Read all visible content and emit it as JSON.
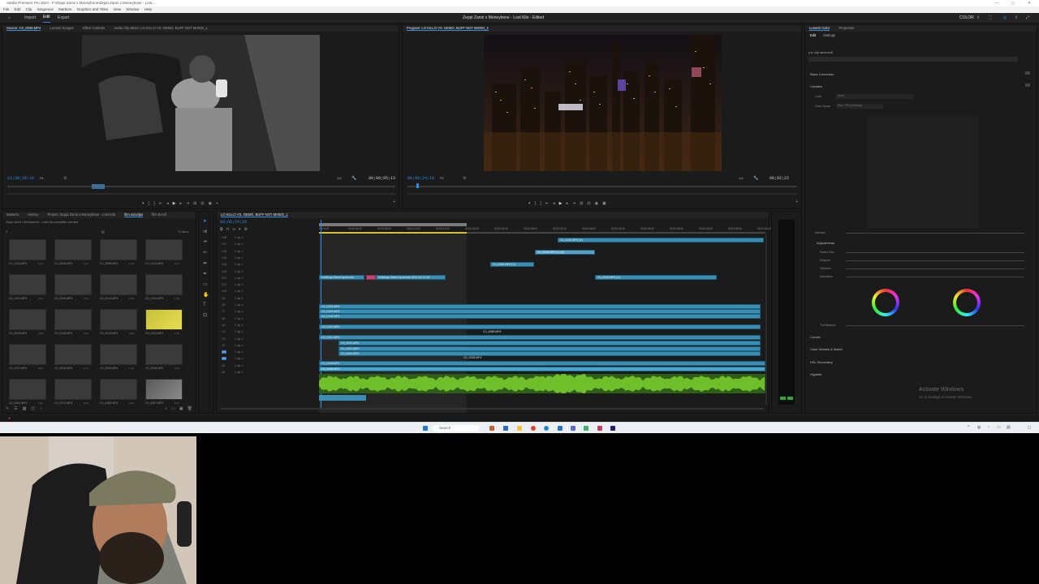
{
  "app": {
    "title": "Adobe Premiere Pro 2024 - F:\\Zeppi Zanni x Moneybone\\Zeppi Zanni x Moneybone - Lost...",
    "center_title": "Zeppi Zanni x Moneybone - Lost Kilo - Edited",
    "menu": [
      "File",
      "Edit",
      "Clip",
      "Sequence",
      "Markers",
      "Graphics and Titles",
      "View",
      "Window",
      "Help"
    ],
    "workspace_tabs": [
      "Import",
      "Edit",
      "Export"
    ],
    "workspace_active": "Edit",
    "right_label": "COLOR"
  },
  "source_monitor": {
    "tabs": [
      "Source: C0_0038.MP4",
      "Lumetri Scopes",
      "Effect Controls",
      "Audio Clip Mixer: LO KILLO VS. DEMO. BUFF NOT MIXED_1"
    ],
    "timecode": "23;38;20;16",
    "fit": "Fit",
    "zoom": "1/4",
    "duration": "00;00;05;13"
  },
  "program_monitor": {
    "tabs": [
      "Program: LO KILLO VS. DEMO. BUFF NOT MIXED_1"
    ],
    "timecode": "00;00;24;18",
    "fit": "Fit",
    "zoom": "1/4",
    "duration": "00;02;22"
  },
  "project_panel": {
    "tabs": [
      "Markers",
      "History",
      "Project: Zeppi Zanni x Moneybone - Lost Kilo",
      "film.subclips",
      "film B-roll"
    ],
    "path": "Zeppi Zanni x Moneybone - Lost Kilo.prproj\\film.subclips",
    "count": "74 items",
    "thumbs": [
      {
        "label": "C0_0134.MP4",
        "dur": "0:12"
      },
      {
        "label": "C0_0065.MP4",
        "dur": "4:12"
      },
      {
        "label": "C0_0086.MP4",
        "dur": "1:09"
      },
      {
        "label": "C0_0123.MP4",
        "dur": "0:17"
      },
      {
        "label": "C0_0101.MP4",
        "dur": "2:14"
      },
      {
        "label": "C0_0040.MP4",
        "dur": "3:22"
      },
      {
        "label": "C0_0014.MP4",
        "dur": "1:02"
      },
      {
        "label": "C0_0124.MP4",
        "dur": "1:15"
      },
      {
        "label": "C0_0035.MP4",
        "dur": "4:06"
      },
      {
        "label": "C0_0108.MP4",
        "dur": "0:19"
      },
      {
        "label": "C0_0019.MP4",
        "dur": "3:06"
      },
      {
        "label": "C0_0113.MP4",
        "dur": "1:12"
      },
      {
        "label": "C0_0137.MP4",
        "dur": "0:23"
      },
      {
        "label": "C0_0026.MP4",
        "dur": "2:13"
      },
      {
        "label": "C0_0032.MP4",
        "dur": "1:10"
      },
      {
        "label": "C0_0049.MP4",
        "dur": "3:16"
      },
      {
        "label": "C0_0091.MP4",
        "dur": "1:06"
      },
      {
        "label": "C0_0012.MP4",
        "dur": "2:03"
      },
      {
        "label": "C0_0083.MP4",
        "dur": "4:20"
      },
      {
        "label": "C0_0057.MP4",
        "dur": "0:14"
      }
    ]
  },
  "timeline": {
    "tab": "LO KILLO VS. DEMO. BUFF NOT MIXED_1",
    "timecode": "00;00;24;18",
    "ruler_labels": [
      "00;00;00",
      "00;00;04;00",
      "00;00;08;00",
      "00;00;12;00",
      "00;00;16;00",
      "00;00;20;00",
      "00;00;24;00",
      "00;00;28;00",
      "00;00;32;00",
      "00;00;36;00",
      "00;00;40;00",
      "00;00;44;00",
      "00;00;48;00",
      "00;00;52;00",
      "00;00;56;00",
      "00;01;00;00"
    ],
    "tracks": [
      "V18",
      "V17",
      "V16",
      "V15",
      "V14",
      "V13",
      "V12",
      "V11",
      "V10",
      "V9",
      "V8",
      "V7",
      "V6",
      "V5",
      "V4",
      "V3",
      "V2",
      "V1",
      "A1",
      "A2",
      "A3"
    ],
    "clips": {
      "top_1": "C0_0134.MP4 [V]",
      "top_2": "C0_0038.MP4 [V] [A]",
      "mid_1": "C0_0086.MP4 [V]",
      "title_1": "buildings.Stand by.shoots",
      "title_2": "buildings.Stand by.shoots 2024-12-17.00",
      "right_1": "C0_0065.MP4 [V]",
      "v7_1": "C0_0134.MP4",
      "v6_1": "C0_0124.MP4",
      "v5_1": "C0_0128.MP4",
      "v4_1": "C0_0122.MP4",
      "v3_1": "C0_0021.MP4",
      "v2_label": "C0_0116.MP4",
      "a1_label": "C0_0020.MP4",
      "mid_float": "C0_0086.MP4",
      "v1_label": "C0_0038.MP4",
      "v1_b": "C0_0019.MP4",
      "v1_c": "C0_0021.MP4",
      "v1_d": "C0_0020.MP4",
      "center_small": "C0_0008.MP4"
    }
  },
  "lumetri": {
    "tabs": [
      "Lumetri Color",
      "Properties"
    ],
    "sub_tabs": [
      "Edit",
      "Settings"
    ],
    "no_clip": "(no clip selected)",
    "sections": [
      "Basic Correction",
      "Creative",
      "Curves",
      "Color Wheels & Match",
      "HSL Secondary",
      "Vignette"
    ],
    "creative_rows": [
      "Look",
      "Color Space"
    ],
    "look_value": "None",
    "colorspace_value": "Rec. 709 (Gamma)",
    "adjustments": "Adjustments",
    "adj_rows": [
      "Faded Film",
      "Sharpen",
      "Vibrance",
      "Saturation"
    ],
    "tint_label": "Tint Balance",
    "intensity": "Intensity",
    "watermark_title": "Activate Windows",
    "watermark_sub": "Go to Settings to activate Windows."
  },
  "taskbar": {
    "search": "Search"
  },
  "colors": {
    "accent": "#2d8ceb",
    "clip_blue": "#3a8db3",
    "clip_pink": "#c04873",
    "audio_green": "#6fbf2b"
  }
}
